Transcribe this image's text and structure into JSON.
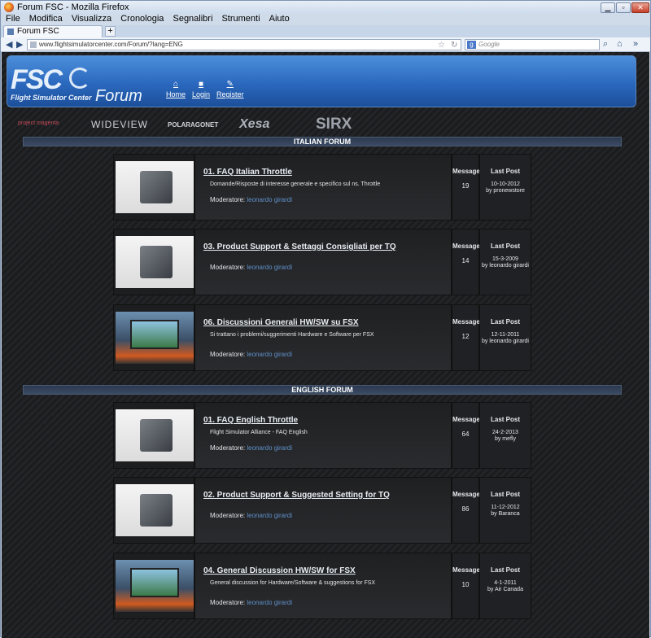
{
  "window": {
    "title": "Forum FSC - Mozilla Firefox"
  },
  "menu": [
    "File",
    "Modifica",
    "Visualizza",
    "Cronologia",
    "Segnalibri",
    "Strumenti",
    "Aiuto"
  ],
  "tab": {
    "label": "Forum FSC",
    "new_tab": "+"
  },
  "address": {
    "url": "www.flightsimulatorcenter.com/Forum/?lang=ENG"
  },
  "search": {
    "engine": "g",
    "placeholder": "Google"
  },
  "site": {
    "logo": "FSC",
    "logo_sub": "Flight Simulator Center",
    "forum_word": "Forum",
    "nav": [
      {
        "label": "Home",
        "icon": "home-icon"
      },
      {
        "label": "Login",
        "icon": "lock-icon"
      },
      {
        "label": "Register",
        "icon": "pencil-icon"
      }
    ],
    "sponsors": [
      "project magenta",
      "WIDEVIEW",
      "POLARAGONET",
      "Xesa",
      "SIRX"
    ]
  },
  "sections": [
    {
      "title": "ITALIAN FORUM",
      "forums": [
        {
          "title": "01. FAQ Italian Throttle",
          "desc": "Domande/Risposte di interesse generale e specifico sul ns. Throttle",
          "mod_label": "Moderatore:",
          "mod": "leonardo girardi",
          "msg_label": "Message",
          "messages": "19",
          "last_label": "Last Post",
          "last_date": "10-10-2012",
          "last_by": "by pronewstore",
          "thumb": "throttle"
        },
        {
          "title": "03. Product Support & Settaggi Consigliati per TQ",
          "desc": "",
          "mod_label": "Moderatore:",
          "mod": "leonardo girardi",
          "msg_label": "Message",
          "messages": "14",
          "last_label": "Last Post",
          "last_date": "15-3-2009",
          "last_by": "by leonardo girardi",
          "thumb": "throttle"
        },
        {
          "title": "06. Discussioni Generali HW/SW su FSX",
          "desc": "Si trattano i problemi/suggerimenti Hardware e Software per FSX",
          "mod_label": "Moderatore:",
          "mod": "leonardo girardi",
          "msg_label": "Message",
          "messages": "12",
          "last_label": "Last Post",
          "last_date": "12-11-2011",
          "last_by": "by leonardo girardi",
          "thumb": "sim"
        }
      ]
    },
    {
      "title": "ENGLISH FORUM",
      "forums": [
        {
          "title": "01. FAQ English Throttle",
          "desc": "Flight Simulator Alliance - FAQ English",
          "mod_label": "Moderatore:",
          "mod": "leonardo girardi",
          "msg_label": "Message",
          "messages": "64",
          "last_label": "Last Post",
          "last_date": "24-2-2013",
          "last_by": "by mefly",
          "thumb": "throttle"
        },
        {
          "title": "02. Product Support & Suggested Setting for TQ",
          "desc": "",
          "mod_label": "Moderatore:",
          "mod": "leonardo girardi",
          "msg_label": "Message",
          "messages": "86",
          "last_label": "Last Post",
          "last_date": "11-12-2012",
          "last_by": "by Baranca",
          "thumb": "throttle"
        },
        {
          "title": "04. General Discussion HW/SW for FSX",
          "desc": "General discussion for Hardware/Software & suggestions for FSX",
          "mod_label": "Moderatore:",
          "mod": "leonardo girardi",
          "msg_label": "Message",
          "messages": "10",
          "last_label": "Last Post",
          "last_date": "4-1-2011",
          "last_by": "by Air Canada",
          "thumb": "sim"
        }
      ]
    }
  ]
}
